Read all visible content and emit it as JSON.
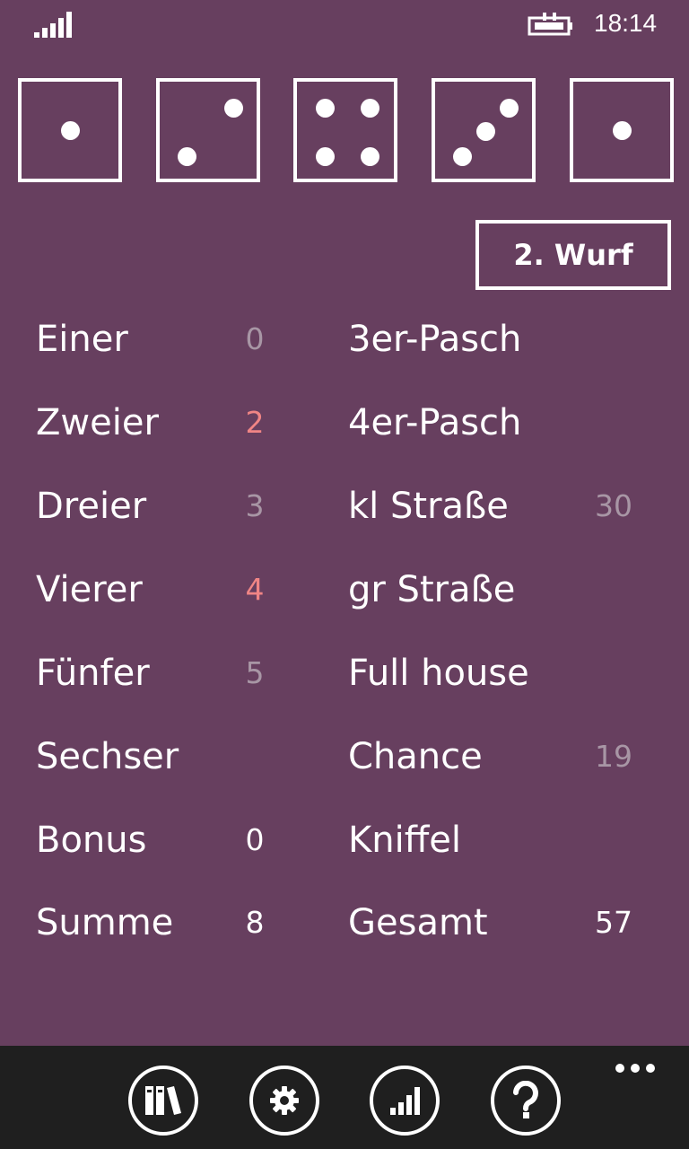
{
  "status": {
    "time": "18:14",
    "signal_icon": "signal-strength-icon",
    "battery_icon": "battery-charging-icon"
  },
  "dice": [
    {
      "value": 1,
      "icon": "die-one-icon"
    },
    {
      "value": 2,
      "icon": "die-two-icon"
    },
    {
      "value": 4,
      "icon": "die-four-icon"
    },
    {
      "value": 3,
      "icon": "die-three-icon"
    },
    {
      "value": 1,
      "icon": "die-one-icon"
    }
  ],
  "roll_button": {
    "label": "2. Wurf"
  },
  "upper": [
    {
      "label": "Einer",
      "value": "0",
      "state": "potential"
    },
    {
      "label": "Zweier",
      "value": "2",
      "state": "highlight"
    },
    {
      "label": "Dreier",
      "value": "3",
      "state": "potential"
    },
    {
      "label": "Vierer",
      "value": "4",
      "state": "highlight"
    },
    {
      "label": "Fünfer",
      "value": "5",
      "state": "potential"
    },
    {
      "label": "Sechser",
      "value": "",
      "state": "potential"
    },
    {
      "label": "Bonus",
      "value": "0",
      "state": "fixed"
    },
    {
      "label": "Summe",
      "value": "8",
      "state": "fixed"
    }
  ],
  "lower": [
    {
      "label": "3er-Pasch",
      "value": "",
      "state": "potential"
    },
    {
      "label": "4er-Pasch",
      "value": "",
      "state": "potential"
    },
    {
      "label": "kl Straße",
      "value": "30",
      "state": "potential"
    },
    {
      "label": "gr Straße",
      "value": "",
      "state": "potential"
    },
    {
      "label": "Full house",
      "value": "",
      "state": "potential"
    },
    {
      "label": "Chance",
      "value": "19",
      "state": "potential"
    },
    {
      "label": "Kniffel",
      "value": "",
      "state": "potential"
    },
    {
      "label": "Gesamt",
      "value": "57",
      "state": "fixed"
    }
  ],
  "appbar": {
    "buttons": [
      {
        "icon": "library-books-icon"
      },
      {
        "icon": "settings-gear-icon"
      },
      {
        "icon": "statistics-chart-icon"
      },
      {
        "icon": "help-question-icon"
      }
    ],
    "more_icon": "more-ellipsis-icon"
  },
  "colors": {
    "background": "#673f5f",
    "potential_value": "#a896a5",
    "highlight_value": "#f08585",
    "appbar": "#1f1f1f"
  }
}
